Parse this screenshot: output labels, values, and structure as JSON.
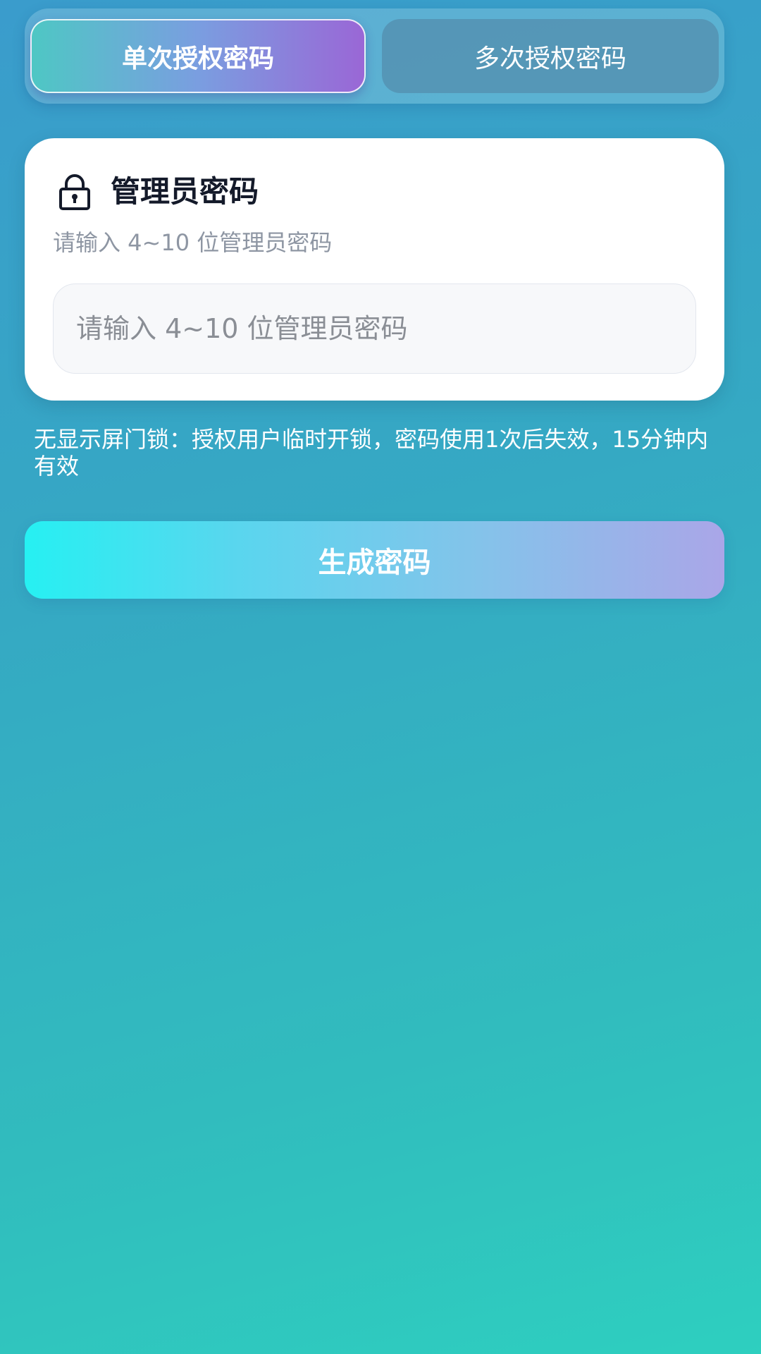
{
  "tabs": {
    "single": "单次授权密码",
    "multi": "多次授权密码"
  },
  "card": {
    "title": "管理员密码",
    "subtitle": "请输入 4~10 位管理员密码",
    "input_placeholder": "请输入 4~10 位管理员密码",
    "input_value": ""
  },
  "note": "无显示屏门锁：授权用户临时开锁，密码使用1次后失效，15分钟内有效",
  "generate_button": "生成密码",
  "icons": {
    "lock": "lock-icon"
  },
  "colors": {
    "background_top": "#3a9ccc",
    "background_bottom": "#2ecfbf",
    "active_tab_start": "#4ec7c4",
    "active_tab_end": "#9a67d6",
    "button_start": "#26f0f2",
    "button_end": "#aaa6e8"
  }
}
